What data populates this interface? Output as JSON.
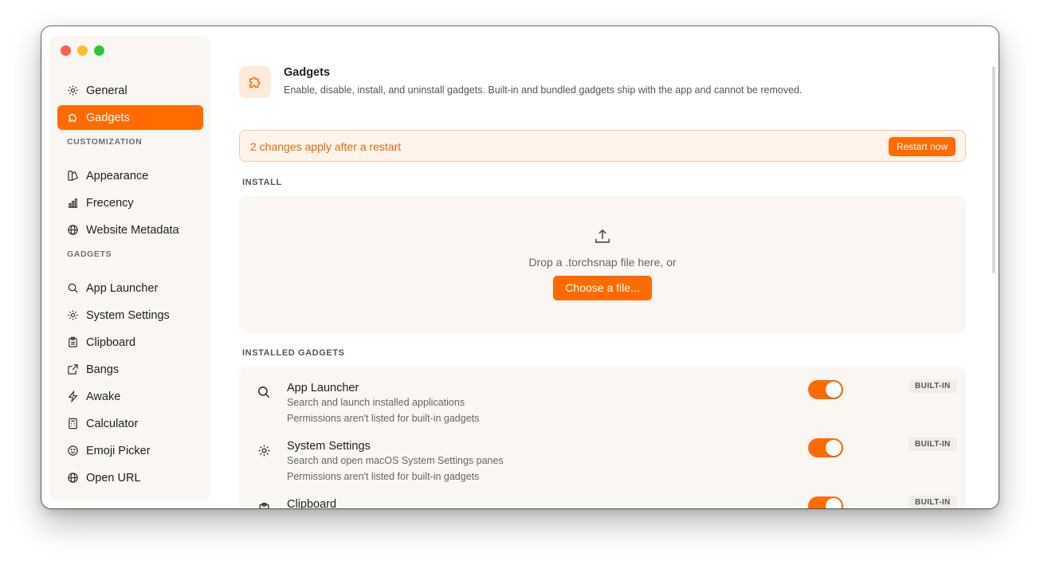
{
  "sidebar": {
    "top_items": [
      {
        "label": "General",
        "icon": "gear-icon"
      },
      {
        "label": "Gadgets",
        "icon": "puzzle-icon"
      }
    ],
    "customization_label": "CUSTOMIZATION",
    "customization_items": [
      {
        "label": "Appearance",
        "icon": "palette-icon"
      },
      {
        "label": "Frecency",
        "icon": "bar-chart-icon"
      },
      {
        "label": "Website Metadata",
        "icon": "globe-icon"
      }
    ],
    "gadgets_label": "GADGETS",
    "gadget_items": [
      {
        "label": "App Launcher",
        "icon": "search-icon"
      },
      {
        "label": "System Settings",
        "icon": "gear-icon"
      },
      {
        "label": "Clipboard",
        "icon": "clipboard-icon"
      },
      {
        "label": "Bangs",
        "icon": "external-link-icon"
      },
      {
        "label": "Awake",
        "icon": "lightning-icon"
      },
      {
        "label": "Calculator",
        "icon": "calculator-icon"
      },
      {
        "label": "Emoji Picker",
        "icon": "smiley-icon"
      },
      {
        "label": "Open URL",
        "icon": "globe-icon"
      }
    ]
  },
  "header": {
    "title": "Gadgets",
    "description": "Enable, disable, install, and uninstall gadgets. Built-in and bundled gadgets ship with the app and cannot be removed.",
    "icon": "puzzle-icon"
  },
  "banner": {
    "text": "2 changes apply after a restart",
    "button": "Restart now"
  },
  "install": {
    "label": "INSTALL",
    "drop_text": "Drop a .torchsnap file here, or",
    "button": "Choose a file...",
    "icon": "upload-icon"
  },
  "installed": {
    "label": "INSTALLED GADGETS",
    "items": [
      {
        "name": "App Launcher",
        "description": "Search and launch installed applications",
        "permissions": "Permissions aren't listed for built-in gadgets",
        "badge": "BUILT-IN",
        "enabled": true,
        "icon": "search-icon"
      },
      {
        "name": "System Settings",
        "description": "Search and open macOS System Settings panes",
        "permissions": "Permissions aren't listed for built-in gadgets",
        "badge": "BUILT-IN",
        "enabled": true,
        "icon": "gear-icon"
      },
      {
        "name": "Clipboard",
        "description": "",
        "permissions": "",
        "badge": "BUILT-IN",
        "enabled": true,
        "icon": "clipboard-icon"
      }
    ]
  },
  "colors": {
    "accent": "#ff6b00",
    "sidebar_bg": "#faf7f2",
    "banner_bg": "#fff3ea"
  }
}
